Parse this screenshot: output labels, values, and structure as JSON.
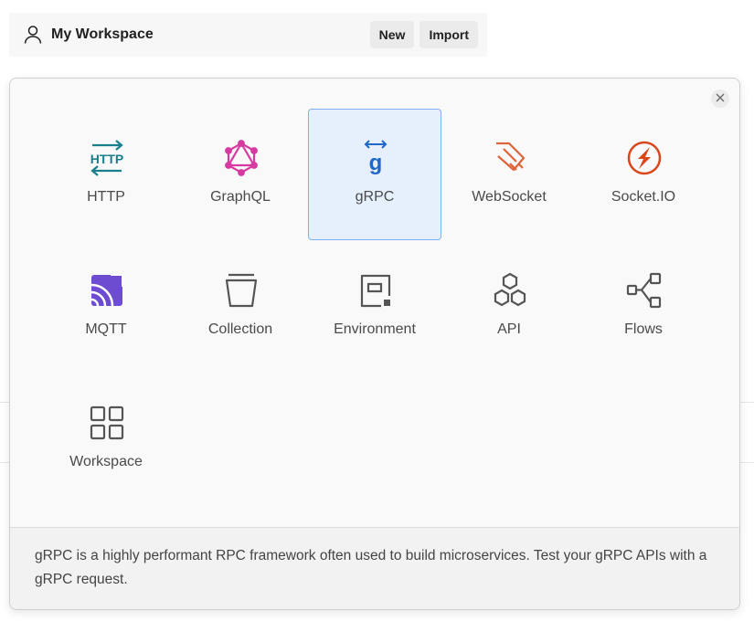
{
  "workspace_bar": {
    "name": "My Workspace",
    "new_label": "New",
    "import_label": "Import"
  },
  "modal": {
    "items": [
      {
        "label": "HTTP",
        "icon": "http-icon",
        "color": "#1a7f8c",
        "selected": false
      },
      {
        "label": "GraphQL",
        "icon": "graphql-icon",
        "color": "#d63aa0",
        "selected": false
      },
      {
        "label": "gRPC",
        "icon": "grpc-icon",
        "color": "#1f67c8",
        "selected": true
      },
      {
        "label": "WebSocket",
        "icon": "websocket-icon",
        "color": "#e0643b",
        "selected": false
      },
      {
        "label": "Socket.IO",
        "icon": "socketio-icon",
        "color": "#d9471c",
        "selected": false
      },
      {
        "label": "MQTT",
        "icon": "mqtt-icon",
        "color": "#6d4cd1",
        "selected": false
      },
      {
        "label": "Collection",
        "icon": "collection-icon",
        "color": "#555555",
        "selected": false
      },
      {
        "label": "Environment",
        "icon": "environment-icon",
        "color": "#555555",
        "selected": false
      },
      {
        "label": "API",
        "icon": "api-icon",
        "color": "#555555",
        "selected": false
      },
      {
        "label": "Flows",
        "icon": "flows-icon",
        "color": "#555555",
        "selected": false
      },
      {
        "label": "Workspace",
        "icon": "workspace-icon",
        "color": "#555555",
        "selected": false
      }
    ],
    "description": "gRPC is a highly performant RPC framework often used to build microservices. Test your gRPC APIs with a gRPC request."
  },
  "colors": {
    "selected_bg": "#e6f0fd",
    "selected_border": "#7fb0f2"
  }
}
